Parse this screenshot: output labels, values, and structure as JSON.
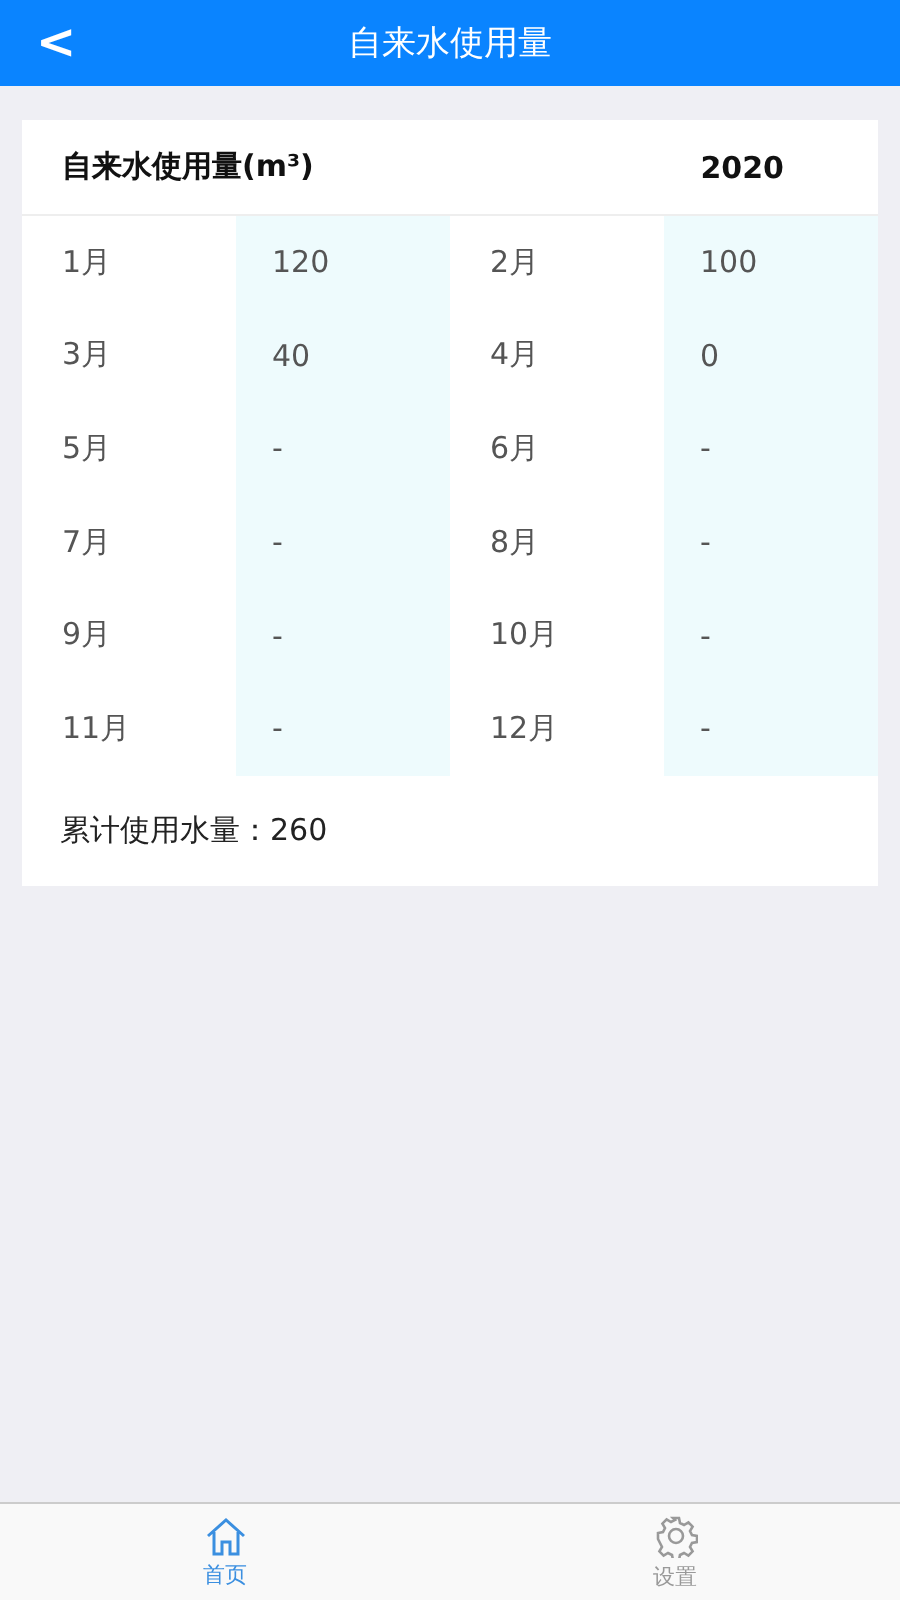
{
  "header": {
    "back": "<",
    "title": "自来水使用量"
  },
  "card": {
    "title": "自来水使用量(m³)",
    "year": "2020",
    "months": [
      {
        "month": "1月",
        "value": "120"
      },
      {
        "month": "2月",
        "value": "100"
      },
      {
        "month": "3月",
        "value": "40"
      },
      {
        "month": "4月",
        "value": "0"
      },
      {
        "month": "5月",
        "value": "-"
      },
      {
        "month": "6月",
        "value": "-"
      },
      {
        "month": "7月",
        "value": "-"
      },
      {
        "month": "8月",
        "value": "-"
      },
      {
        "month": "9月",
        "value": "-"
      },
      {
        "month": "10月",
        "value": "-"
      },
      {
        "month": "11月",
        "value": "-"
      },
      {
        "month": "12月",
        "value": "-"
      }
    ],
    "total": "累计使用水量：260"
  },
  "tabs": [
    {
      "label": "首页",
      "kind": "home",
      "selected": true
    },
    {
      "label": "设置",
      "kind": "settings",
      "selected": false
    }
  ]
}
